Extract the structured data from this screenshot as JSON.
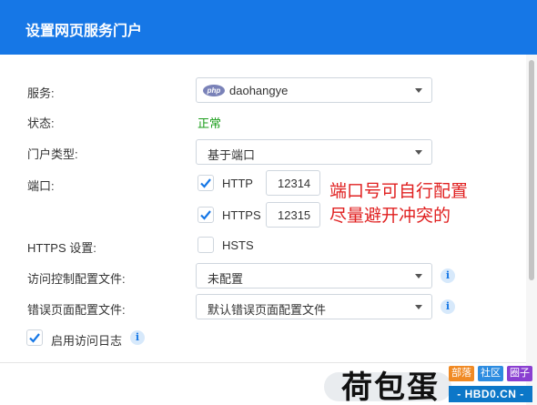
{
  "dialog": {
    "title": "设置网页服务门户"
  },
  "form": {
    "service": {
      "label": "服务:",
      "value": "daohangye",
      "icon": "php-icon",
      "icon_text": "php"
    },
    "status": {
      "label": "状态:",
      "value": "正常",
      "color": "#1a9d1a"
    },
    "portal_type": {
      "label": "门户类型:",
      "value": "基于端口"
    },
    "port": {
      "label": "端口:",
      "http": {
        "label": "HTTP",
        "checked": true,
        "value": "12314"
      },
      "https": {
        "label": "HTTPS",
        "checked": true,
        "value": "12315"
      }
    },
    "https_settings": {
      "label": "HTTPS 设置:",
      "hsts": {
        "label": "HSTS",
        "checked": false
      }
    },
    "access_control": {
      "label": "访问控制配置文件:",
      "value": "未配置"
    },
    "error_page": {
      "label": "错误页面配置文件:",
      "value": "默认错误页面配置文件"
    },
    "access_log": {
      "label": "启用访问日志",
      "checked": true
    },
    "info_icon": "i"
  },
  "annotation": {
    "line1": "端口号可自行配置",
    "line2": "尽量避开冲突的",
    "color": "#e02020"
  },
  "watermark": {
    "text": "荷包蛋",
    "tags": [
      {
        "label": "部落",
        "color": "#f08a24"
      },
      {
        "label": "社区",
        "color": "#2d8ce0"
      },
      {
        "label": "圈子",
        "color": "#8a3fd1"
      }
    ],
    "url": "- HBD0.CN -"
  },
  "colors": {
    "accent": "#1677e6",
    "border": "#cfd6de"
  }
}
